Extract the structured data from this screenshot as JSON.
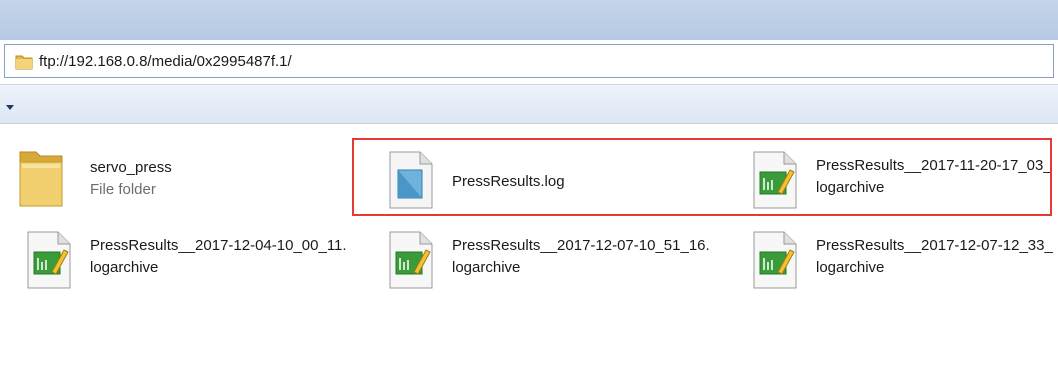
{
  "address": {
    "path": "ftp://192.168.0.8/media/0x2995487f.1/",
    "icon": "folder-icon"
  },
  "toolbar": {
    "dropdown_icon": "dropdown-arrow-icon"
  },
  "files": [
    {
      "line1": "servo_press",
      "line2": "File folder",
      "icon": "folder-icon"
    },
    {
      "line1": "PressResults.log",
      "line2": "",
      "icon": "notepad-document-icon"
    },
    {
      "line1": "PressResults__2017-11-20-17_03_",
      "line2": "logarchive",
      "icon": "logarchive-file-icon"
    },
    {
      "line1": "PressResults__2017-12-04-10_00_11.",
      "line2": "logarchive",
      "icon": "logarchive-file-icon"
    },
    {
      "line1": "PressResults__2017-12-07-10_51_16.",
      "line2": "logarchive",
      "icon": "logarchive-file-icon"
    },
    {
      "line1": "PressResults__2017-12-07-12_33_",
      "line2": "logarchive",
      "icon": "logarchive-file-icon"
    }
  ],
  "colors": {
    "highlight": "#e53935",
    "header_band": "#b7c9e4",
    "toolbar": "#dde7f4"
  }
}
